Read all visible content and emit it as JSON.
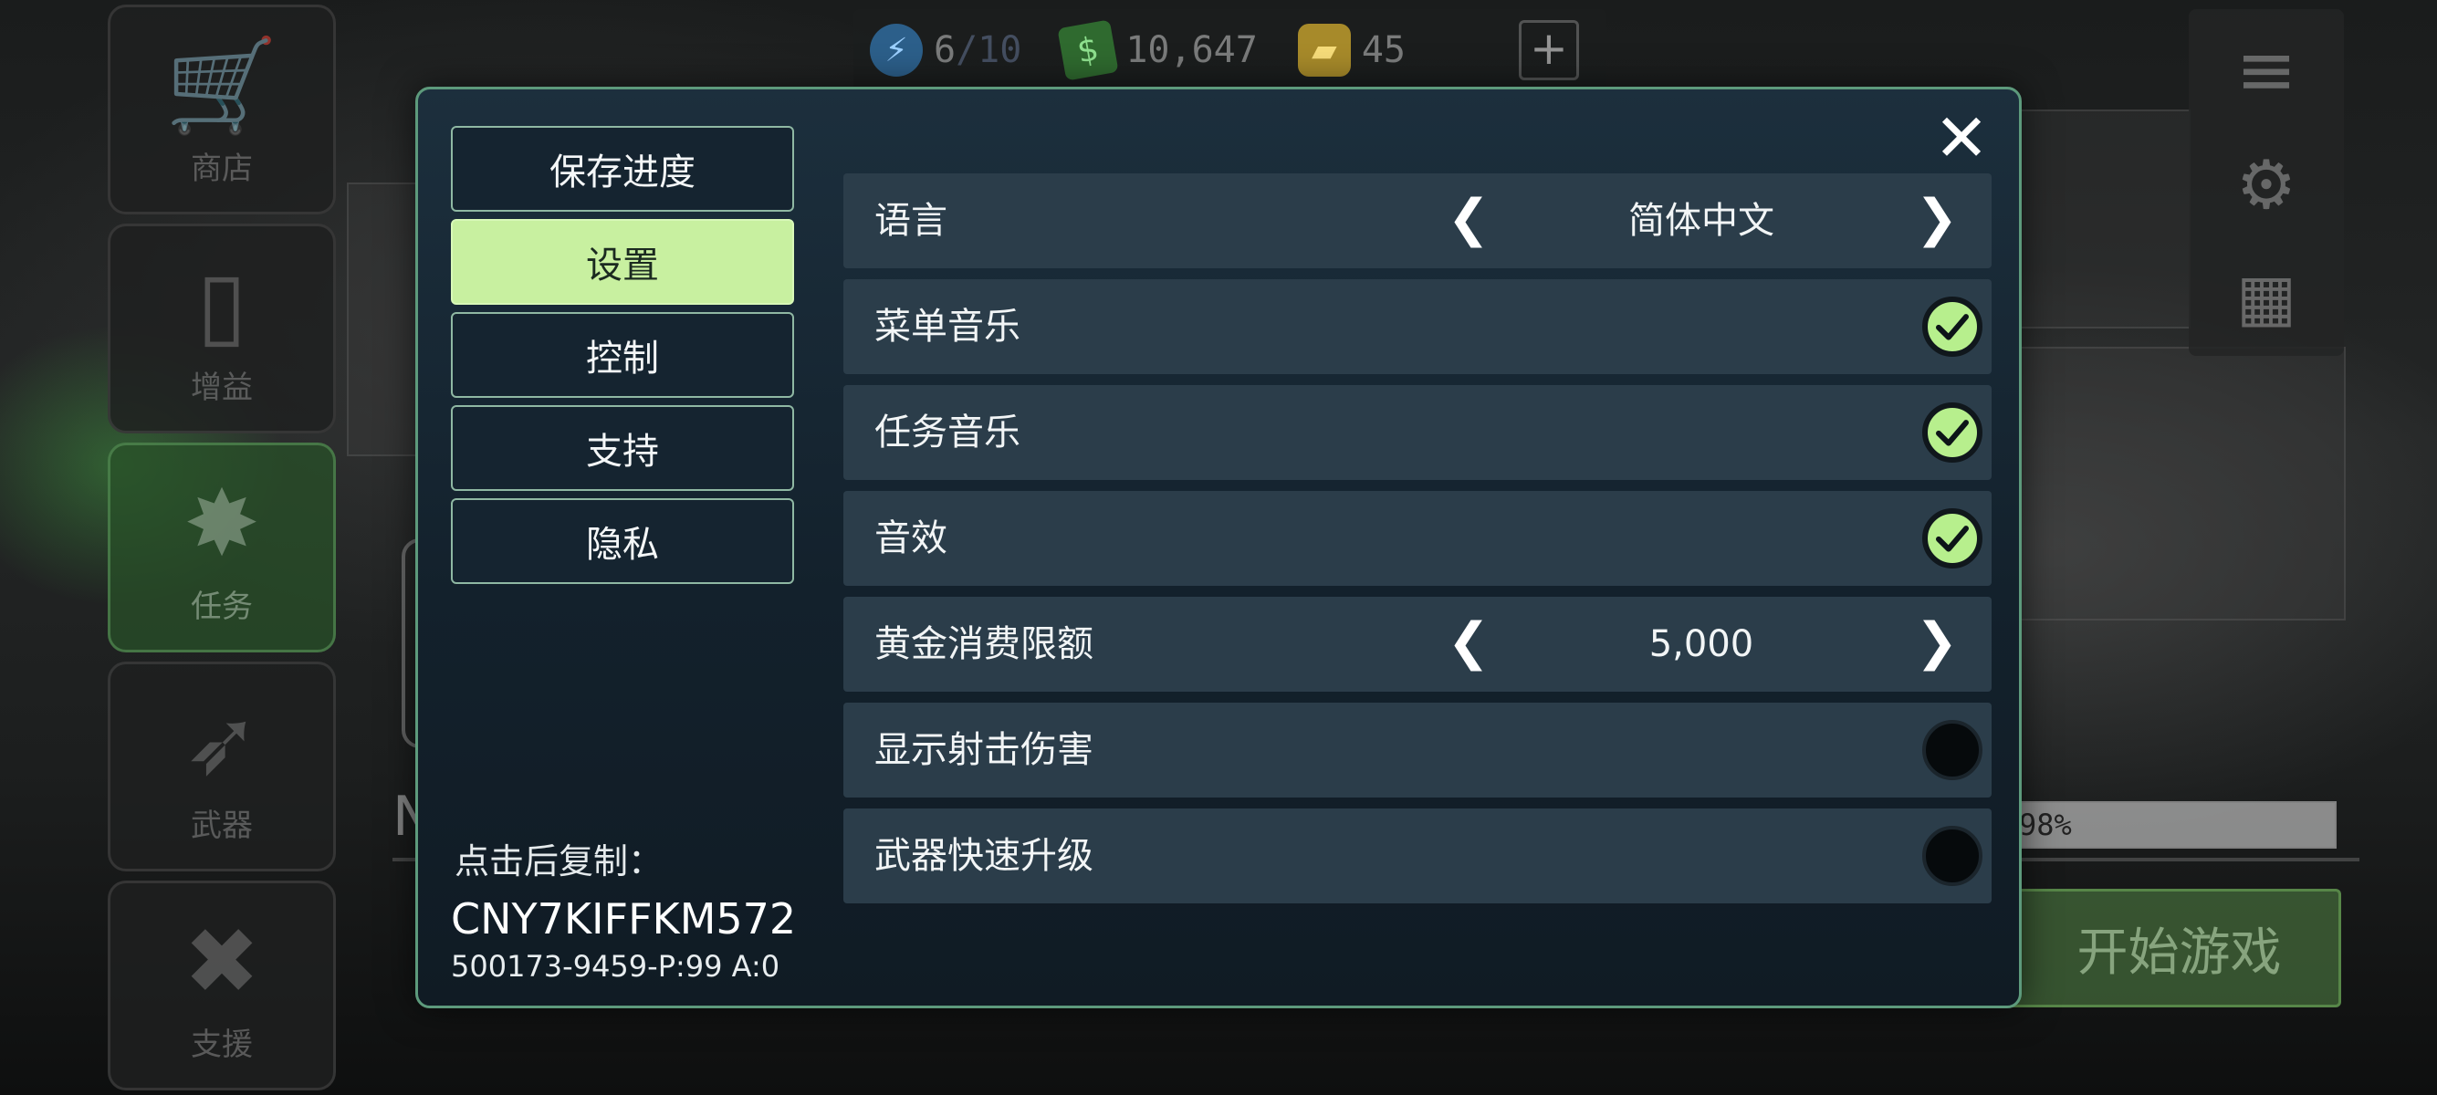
{
  "background": {
    "side_nav": [
      {
        "label": "商店",
        "icon": "cart-icon"
      },
      {
        "label": "增益",
        "icon": "cards-icon"
      },
      {
        "label": "任务",
        "icon": "explosion-icon"
      },
      {
        "label": "武器",
        "icon": "missile-icon"
      },
      {
        "label": "支援",
        "icon": "tools-icon"
      }
    ],
    "resources": {
      "energy_current": "6",
      "energy_max": "/10",
      "cash": "10,647",
      "gold": "45",
      "plus": "+"
    },
    "progress_text": "98%",
    "start_button": "开始游戏",
    "partial_letter": "N"
  },
  "modal": {
    "close_symbol": "✕",
    "tabs": [
      {
        "label": "保存进度",
        "active": false
      },
      {
        "label": "设置",
        "active": true
      },
      {
        "label": "控制",
        "active": false
      },
      {
        "label": "支持",
        "active": false
      },
      {
        "label": "隐私",
        "active": false
      }
    ],
    "copy": {
      "label": "点击后复制：",
      "code": "CNY7KIFFKM572",
      "id": "500173-9459-P:99 A:0"
    },
    "settings": [
      {
        "label": "语言",
        "type": "selector",
        "value": "简体中文"
      },
      {
        "label": "菜单音乐",
        "type": "toggle",
        "on": true
      },
      {
        "label": "任务音乐",
        "type": "toggle",
        "on": true
      },
      {
        "label": "音效",
        "type": "toggle",
        "on": true
      },
      {
        "label": "黄金消费限额",
        "type": "selector",
        "value": "5,000"
      },
      {
        "label": "显示射击伤害",
        "type": "toggle",
        "on": false
      },
      {
        "label": "武器快速升级",
        "type": "toggle",
        "on": false
      }
    ],
    "colors": {
      "accent_active_tab": "#c8f0a0",
      "toggle_on": "#b7ef8d",
      "modal_border": "#5d9a7c"
    }
  }
}
